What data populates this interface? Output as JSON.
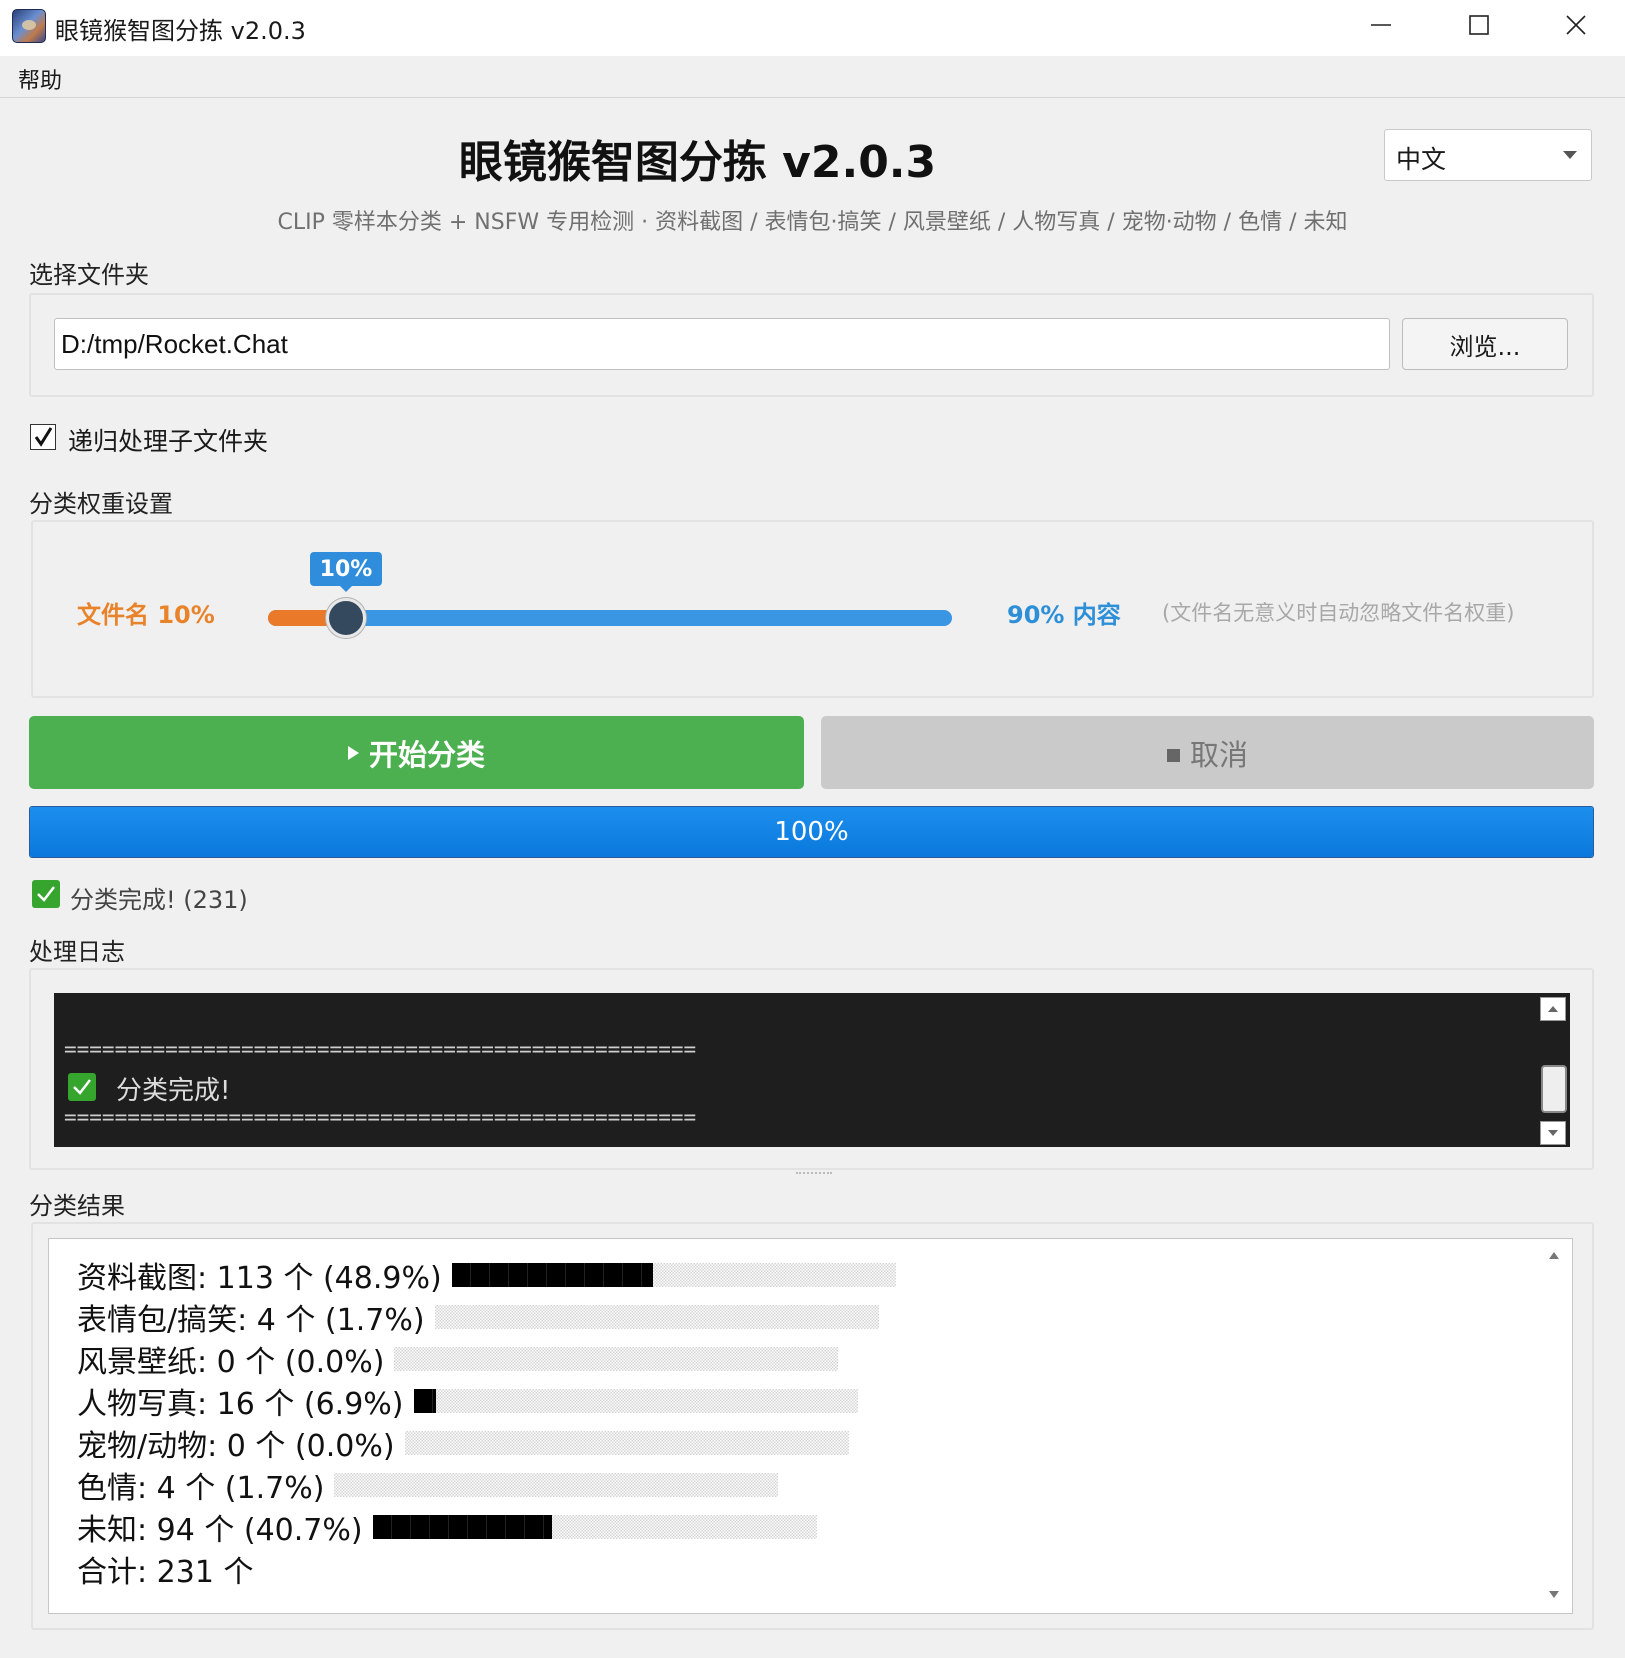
{
  "window": {
    "title": "眼镜猴智图分拣 v2.0.3",
    "app_icon": "tarsier-app-icon",
    "controls": [
      "minimize-icon",
      "maximize-icon",
      "close-icon"
    ]
  },
  "menu": {
    "items": [
      {
        "label": "帮助"
      }
    ]
  },
  "header": {
    "title": "眼镜猴智图分拣 v2.0.3",
    "subtitle": "CLIP 零样本分类 + NSFW 专用检测 · 资料截图 / 表情包·搞笑 / 风景壁纸 / 人物写真 / 宠物·动物 / 色情 / 未知",
    "language": "中文"
  },
  "folder": {
    "label": "选择文件夹",
    "path": "D:/tmp/Rocket.Chat",
    "browse_label": "浏览..."
  },
  "recursive": {
    "label": "递归处理子文件夹",
    "checked": true
  },
  "weights": {
    "label": "分类权重设置",
    "left_label": "文件名 10%",
    "right_label": "90% 内容",
    "hint": "(文件名无意义时自动忽略文件名权重)",
    "tooltip": "10%",
    "value": 0.1
  },
  "actions": {
    "start_label": "开始分类",
    "cancel_label": "取消"
  },
  "progress": {
    "text": "100%",
    "value": 1.0
  },
  "status": {
    "text": "分类完成!  (231)"
  },
  "log": {
    "label": "处理日志",
    "separator": "==================================================",
    "line": "分类完成!"
  },
  "results": {
    "label": "分类结果",
    "rows": [
      {
        "text": "资料截图: 113 个 (48.9%)",
        "fraction": 0.452
      },
      {
        "text": "表情包/搞笑: 4 个 (1.7%)",
        "fraction": 0
      },
      {
        "text": "风景壁纸: 0 个 (0.0%)",
        "fraction": 0
      },
      {
        "text": "人物写真: 16 个 (6.9%)",
        "fraction": 0.05
      },
      {
        "text": "宠物/动物: 0 个 (0.0%)",
        "fraction": 0
      },
      {
        "text": "色情: 4 个 (1.7%)",
        "fraction": 0
      },
      {
        "text": "未知: 94 个 (40.7%)",
        "fraction": 0.403
      }
    ],
    "total": "合计: 231 个"
  },
  "colors": {
    "start_green": "#4caf50",
    "progress_blue": "#0a78dc",
    "slider_orange": "#ea7a2a",
    "slider_blue": "#3a95e2",
    "check_green": "#35a52d"
  }
}
